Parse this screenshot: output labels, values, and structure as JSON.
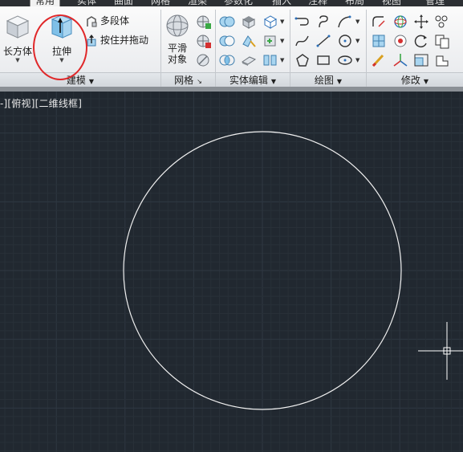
{
  "tabs": [
    "常用",
    "实体",
    "曲面",
    "网格",
    "渲染",
    "参数化",
    "插入",
    "注释",
    "布局",
    "视图",
    "管理"
  ],
  "active_tab": "常用",
  "panels": {
    "modeling": {
      "title": "建模",
      "box_label": "长方体",
      "extrude_label": "拉伸",
      "polysolid_label": "多段体",
      "presspull_label": "按住并拖动"
    },
    "mesh": {
      "title": "网格",
      "smooth_label_1": "平滑",
      "smooth_label_2": "对象"
    },
    "solid_edit": {
      "title": "实体编辑"
    },
    "draw": {
      "title": "绘图"
    },
    "modify": {
      "title": "修改"
    }
  },
  "viewport": {
    "label": "-][俯视][二维线框]"
  },
  "colors": {
    "canvas": "#212830",
    "grid_minor": "#283038",
    "grid_major": "#2f3842",
    "circle": "#f0f0f0",
    "annotation": "#e0282a"
  }
}
